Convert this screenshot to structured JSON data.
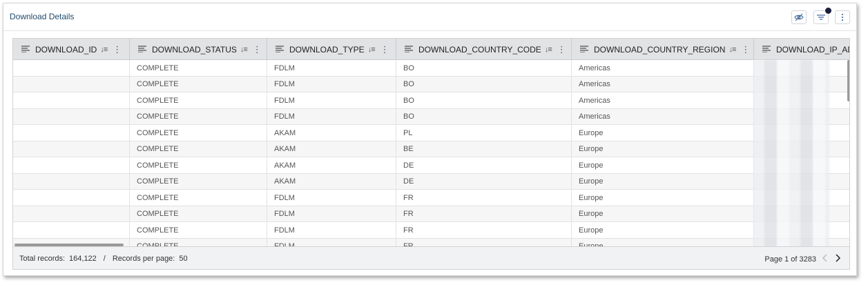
{
  "panel": {
    "title": "Download Details",
    "icons": [
      "eye-slash-icon",
      "filter-icon",
      "more-vertical-icon"
    ],
    "filter_dot_color": "#1b1e3b"
  },
  "table": {
    "columns": [
      {
        "label": "DOWNLOAD_ID",
        "sort_icon": "↓≡"
      },
      {
        "label": "DOWNLOAD_STATUS",
        "sort_icon": "↓≡"
      },
      {
        "label": "DOWNLOAD_TYPE",
        "sort_icon": "↓≡"
      },
      {
        "label": "DOWNLOAD_COUNTRY_CODE",
        "sort_icon": "↓≡"
      },
      {
        "label": "DOWNLOAD_COUNTRY_REGION",
        "sort_icon": "↓≡"
      },
      {
        "label": "DOWNLOAD_IP_AD",
        "sort_icon": ""
      }
    ],
    "rows": [
      [
        "",
        "COMPLETE",
        "FDLM",
        "BO",
        "Americas"
      ],
      [
        "",
        "COMPLETE",
        "FDLM",
        "BO",
        "Americas"
      ],
      [
        "",
        "COMPLETE",
        "FDLM",
        "BO",
        "Americas"
      ],
      [
        "",
        "COMPLETE",
        "FDLM",
        "BO",
        "Americas"
      ],
      [
        "",
        "COMPLETE",
        "AKAM",
        "PL",
        "Europe"
      ],
      [
        "",
        "COMPLETE",
        "AKAM",
        "BE",
        "Europe"
      ],
      [
        "",
        "COMPLETE",
        "AKAM",
        "DE",
        "Europe"
      ],
      [
        "",
        "COMPLETE",
        "AKAM",
        "DE",
        "Europe"
      ],
      [
        "",
        "COMPLETE",
        "FDLM",
        "FR",
        "Europe"
      ],
      [
        "",
        "COMPLETE",
        "FDLM",
        "FR",
        "Europe"
      ],
      [
        "",
        "COMPLETE",
        "FDLM",
        "FR",
        "Europe"
      ],
      [
        "",
        "COMPLETE",
        "FDLM",
        "FR",
        "Europe"
      ]
    ]
  },
  "footer": {
    "total_label": "Total records:",
    "total_value": "164,122",
    "separator": "/",
    "per_page_label": "Records per page:",
    "per_page_value": "50",
    "page_text": "Page 1 of 3283"
  }
}
